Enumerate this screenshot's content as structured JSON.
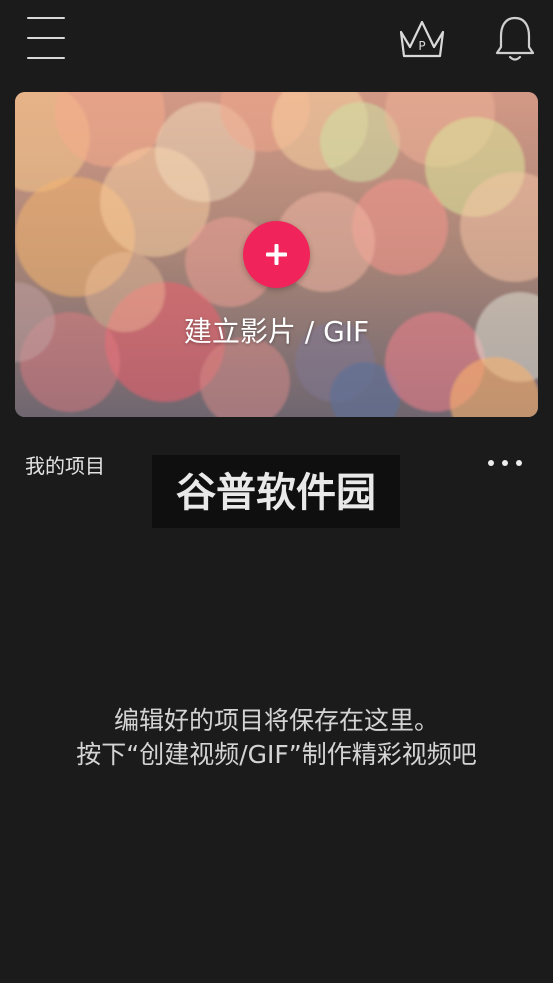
{
  "header": {
    "menu_icon": "hamburger-menu-icon",
    "premium_icon": "crown-icon",
    "premium_badge": "P",
    "notifications_icon": "bell-icon"
  },
  "hero": {
    "create_icon": "plus-icon",
    "create_label": "建立影片 / GIF",
    "accent_color": "#f0245a"
  },
  "projects": {
    "section_title": "我的项目",
    "more_icon": "more-dots-icon",
    "empty_line1": "编辑好的项目将保存在这里。",
    "empty_line2": "按下“创建视频/GIF”制作精彩视频吧"
  },
  "watermark": {
    "text": "谷普软件园"
  }
}
